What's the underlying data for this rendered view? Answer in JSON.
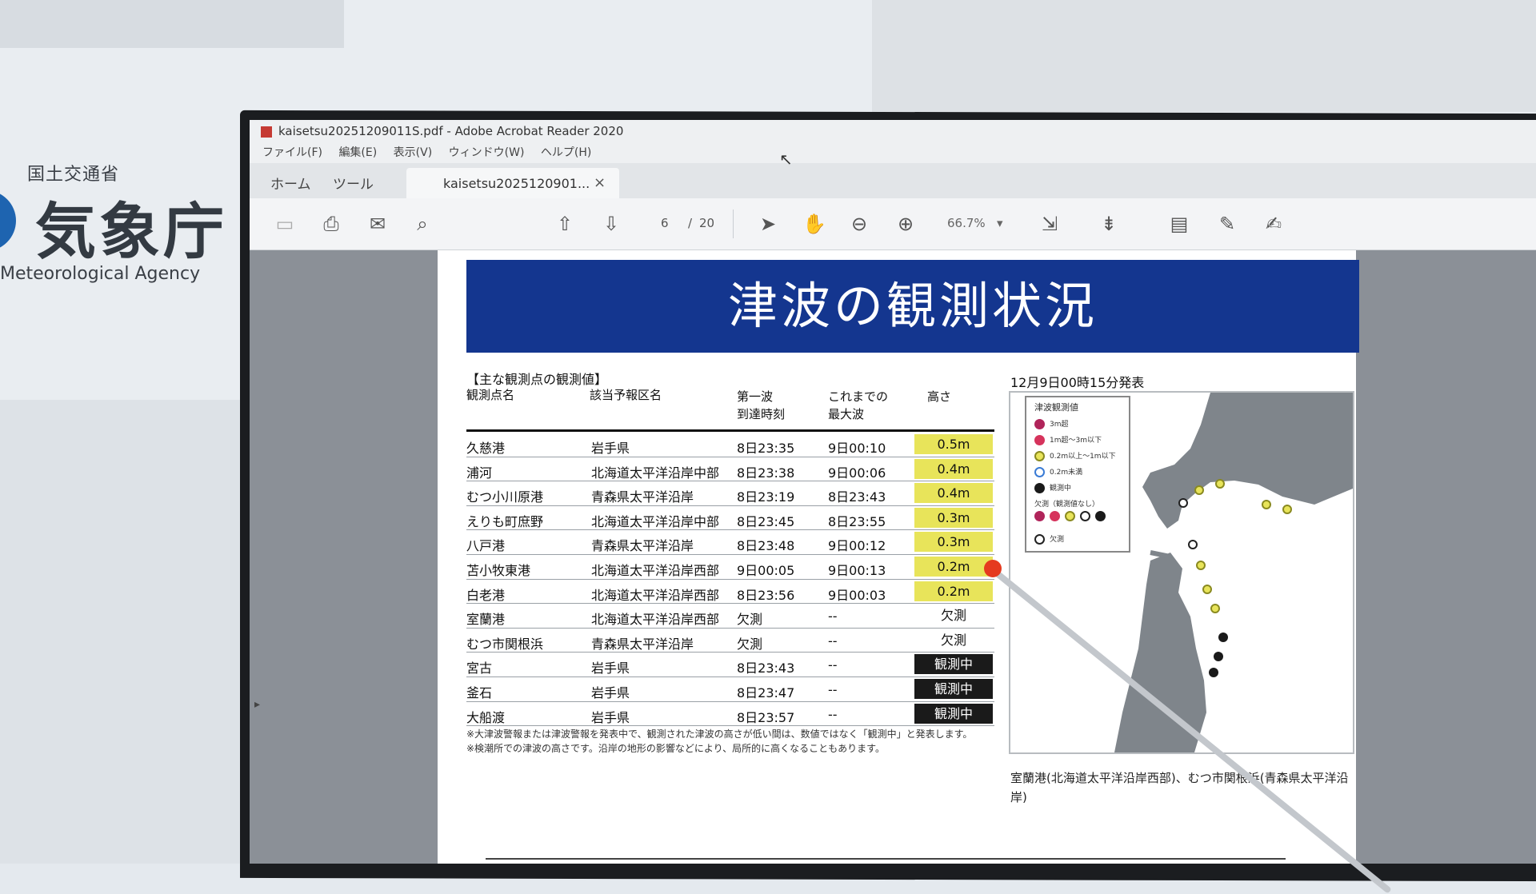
{
  "logo": {
    "ministry": "国土交通省",
    "agency": "気象庁",
    "english": "Meteorological Agency"
  },
  "window": {
    "title": "kaisetsu20251209011S.pdf - Adobe Acrobat Reader 2020",
    "menu": [
      "ファイル(F)",
      "編集(E)",
      "表示(V)",
      "ウィンドウ(W)",
      "ヘルプ(H)"
    ],
    "tabs": {
      "home": "ホーム",
      "tools": "ツール",
      "doc": "kaisetsu2025120901...",
      "close": "×"
    },
    "toolbar": {
      "page_current": "6",
      "page_sep": "/",
      "page_total": "20",
      "zoom": "66.7%"
    }
  },
  "page": {
    "title": "津波の観測状況",
    "subhead": "【主な観測点の観測値】",
    "headers": {
      "station": "観測点名",
      "region": "該当予報区名",
      "first_wave": "第一波",
      "arrival": "到達時刻",
      "so_far": "これまでの",
      "max_wave": "最大波",
      "height": "高さ"
    },
    "rows": [
      {
        "station": "久慈港",
        "region": "岩手県",
        "arrival": "8日23:35",
        "max": "9日00:10",
        "height": "0.5m",
        "style": "yellow"
      },
      {
        "station": "浦河",
        "region": "北海道太平洋沿岸中部",
        "arrival": "8日23:38",
        "max": "9日00:06",
        "height": "0.4m",
        "style": "yellow"
      },
      {
        "station": "むつ小川原港",
        "region": "青森県太平洋沿岸",
        "arrival": "8日23:19",
        "max": "8日23:43",
        "height": "0.4m",
        "style": "yellow"
      },
      {
        "station": "えりも町庶野",
        "region": "北海道太平洋沿岸中部",
        "arrival": "8日23:45",
        "max": "8日23:55",
        "height": "0.3m",
        "style": "yellow"
      },
      {
        "station": "八戸港",
        "region": "青森県太平洋沿岸",
        "arrival": "8日23:48",
        "max": "9日00:12",
        "height": "0.3m",
        "style": "yellow"
      },
      {
        "station": "苫小牧東港",
        "region": "北海道太平洋沿岸西部",
        "arrival": "9日00:05",
        "max": "9日00:13",
        "height": "0.2m",
        "style": "yellow"
      },
      {
        "station": "白老港",
        "region": "北海道太平洋沿岸西部",
        "arrival": "8日23:56",
        "max": "9日00:03",
        "height": "0.2m",
        "style": "yellow"
      },
      {
        "station": "室蘭港",
        "region": "北海道太平洋沿岸西部",
        "arrival": "欠測",
        "max": "--",
        "height": "欠測",
        "style": "none"
      },
      {
        "station": "むつ市関根浜",
        "region": "青森県太平洋沿岸",
        "arrival": "欠測",
        "max": "--",
        "height": "欠測",
        "style": "none"
      },
      {
        "station": "宮古",
        "region": "岩手県",
        "arrival": "8日23:43",
        "max": "--",
        "height": "観測中",
        "style": "black"
      },
      {
        "station": "釜石",
        "region": "岩手県",
        "arrival": "8日23:47",
        "max": "--",
        "height": "観測中",
        "style": "black"
      },
      {
        "station": "大船渡",
        "region": "岩手県",
        "arrival": "8日23:57",
        "max": "--",
        "height": "観測中",
        "style": "black"
      }
    ],
    "notes": [
      "※大津波警報または津波警報を発表中で、観測された津波の高さが低い間は、数値ではなく「観測中」と発表します。",
      "※検潮所での津波の高さです。沿岸の地形の影響などにより、局所的に高くなることもあります。"
    ],
    "map_date": "12月9日00時15分発表",
    "legend_title": "津波観測値",
    "legend_items": [
      "3m超",
      "1m超～3m以下",
      "0.2m以上～1m以下",
      "0.2m未満",
      "観測中"
    ],
    "legend_sub": "欠測（観測値なし）",
    "legend_missing": "欠測",
    "map_note": "室蘭港(北海道太平洋沿岸西部)、むつ市関根浜(青森県太平洋沿岸)"
  },
  "colors": {
    "banner": "#14368f",
    "yellow": "#e8e45a",
    "black": "#1a1a1a"
  }
}
